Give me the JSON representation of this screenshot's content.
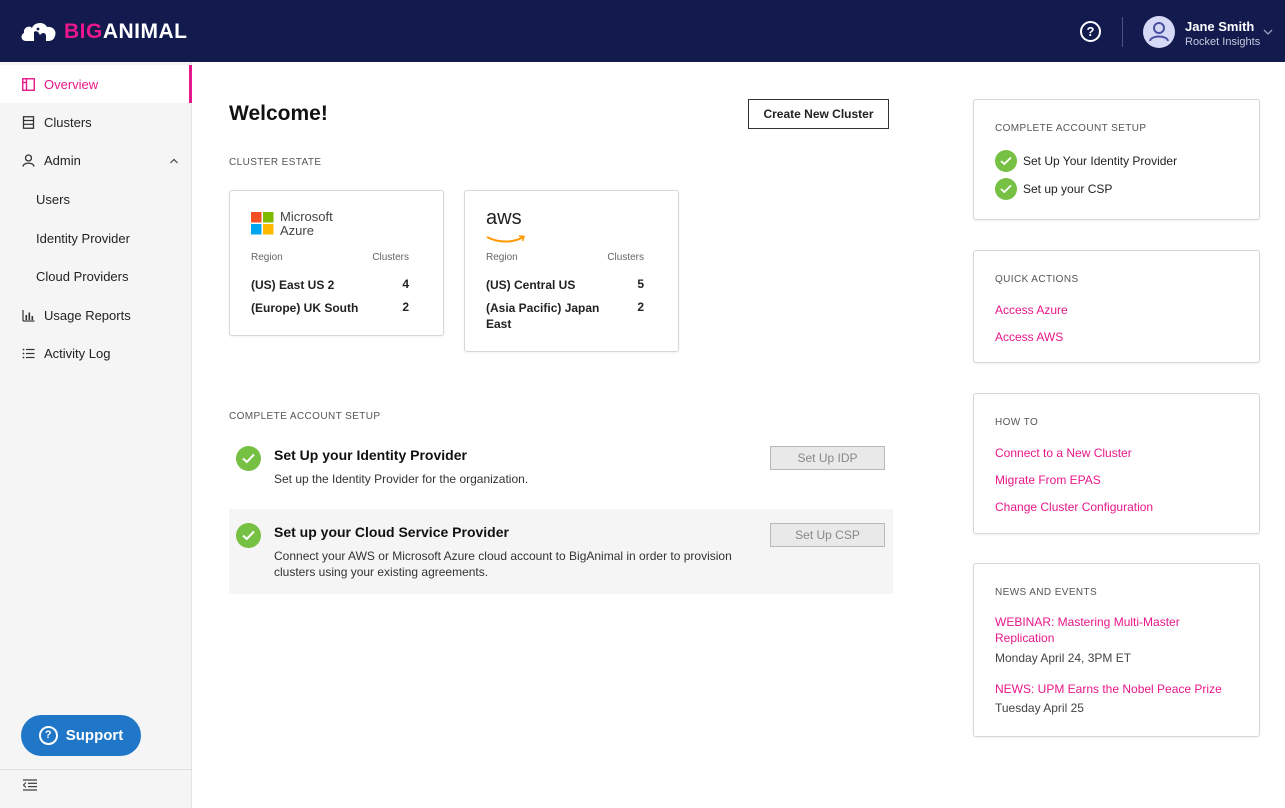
{
  "header": {
    "logo_big": "BIG",
    "logo_animal": "ANIMAL",
    "help_glyph": "?",
    "user_name": "Jane Smith",
    "user_org": "Rocket Insights"
  },
  "sidebar": {
    "items": [
      {
        "label": "Overview",
        "icon": "overview-icon"
      },
      {
        "label": "Clusters",
        "icon": "clusters-icon"
      },
      {
        "label": "Admin",
        "icon": "user-icon"
      },
      {
        "label": "Users"
      },
      {
        "label": "Identity Provider"
      },
      {
        "label": "Cloud Providers"
      },
      {
        "label": "Usage Reports",
        "icon": "bar-chart-icon"
      },
      {
        "label": "Activity Log",
        "icon": "list-icon"
      }
    ],
    "support_label": "Support",
    "support_glyph": "?"
  },
  "main": {
    "welcome": "Welcome!",
    "create_cluster_label": "Create New Cluster",
    "cluster_estate_title": "CLUSTER ESTATE",
    "estates": [
      {
        "provider_line1": "Microsoft",
        "provider_line2": "Azure",
        "region_head": "Region",
        "clusters_head": "Clusters",
        "rows": [
          {
            "region": "(US) East US 2",
            "count": "4"
          },
          {
            "region": "(Europe) UK South",
            "count": "2"
          }
        ]
      },
      {
        "provider_line1": "aws",
        "region_head": "Region",
        "clusters_head": "Clusters",
        "rows": [
          {
            "region": "(US) Central US",
            "count": "5"
          },
          {
            "region": "(Asia Pacific) Japan East",
            "count": "2"
          }
        ]
      }
    ],
    "setup_title": "COMPLETE ACCOUNT SETUP",
    "setup_items": [
      {
        "title": "Set Up your Identity Provider",
        "desc": "Set up the Identity Provider for the organization.",
        "button": "Set Up IDP"
      },
      {
        "title": "Set up your Cloud Service Provider",
        "desc": "Connect your AWS or Microsoft Azure cloud account to BigAnimal in order to provision clusters using your existing agreements.",
        "button": "Set Up CSP"
      }
    ]
  },
  "right": {
    "account_setup": {
      "title": "COMPLETE ACCOUNT SETUP",
      "items": [
        "Set Up Your Identity Provider",
        "Set up your CSP"
      ]
    },
    "quick_actions": {
      "title": "QUICK ACTIONS",
      "links": [
        "Access Azure",
        "Access AWS"
      ]
    },
    "how_to": {
      "title": "HOW TO",
      "links": [
        "Connect to a New Cluster",
        "Migrate From EPAS",
        "Change Cluster Configuration"
      ]
    },
    "news": {
      "title": "NEWS AND EVENTS",
      "items": [
        {
          "link": "WEBINAR: Mastering Multi-Master Replication",
          "date": "Monday April 24, 3PM ET"
        },
        {
          "link": "NEWS: UPM Earns the Nobel Peace Prize",
          "date": "Tuesday April 25"
        }
      ]
    }
  },
  "colors": {
    "brand_navy": "#121a4e",
    "accent_pink": "#e8178a",
    "success_green": "#76c043",
    "support_blue": "#2177c7"
  }
}
